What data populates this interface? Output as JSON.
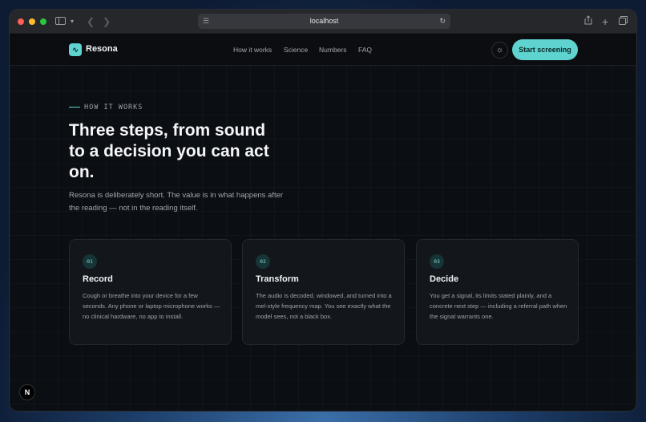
{
  "browser": {
    "url": "localhost",
    "icons": {
      "sidebar": "sidebar-icon",
      "back": "back-icon",
      "forward": "forward-icon",
      "share": "share-icon",
      "new_tab": "plus-icon",
      "tabs": "tabs-icon",
      "translate": "translate-icon",
      "reload": "reload-icon"
    }
  },
  "nav": {
    "brand": "Resona",
    "links": [
      "How it works",
      "Science",
      "Numbers",
      "FAQ"
    ],
    "cta": "Start screening"
  },
  "hero": {
    "eyebrow": "HOW IT WORKS",
    "headline": "Three steps, from sound to a decision you can act on.",
    "subtext": "Resona is deliberately short. The value is in what happens after the reading — not in the reading itself."
  },
  "steps": [
    {
      "num": "01",
      "title": "Record",
      "body": "Cough or breathe into your device for a few seconds. Any phone or laptop microphone works — no clinical hardware, no app to install."
    },
    {
      "num": "02",
      "title": "Transform",
      "body": "The audio is decoded, windowed, and turned into a mel-style frequency map. You see exactly what the model sees, not a black box."
    },
    {
      "num": "03",
      "title": "Decide",
      "body": "You get a signal, its limits stated plainly, and a concrete next step — including a referral path when the signal warrants one."
    }
  ],
  "badge": "N",
  "colors": {
    "accent": "#5ed3cf",
    "background": "#0b0e12",
    "card": "#13171c"
  }
}
